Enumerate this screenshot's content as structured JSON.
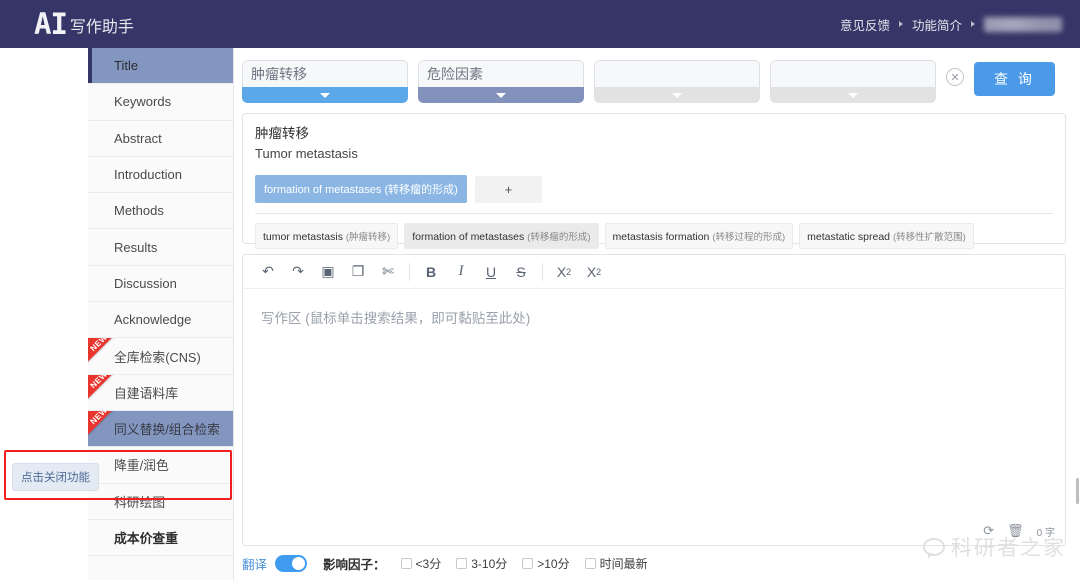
{
  "header": {
    "logo_ai": "AI",
    "logo_cn": "写作助手",
    "links": [
      {
        "label": "意见反馈"
      },
      {
        "label": "功能简介"
      }
    ],
    "blurred_account": ""
  },
  "sidebar": {
    "items": [
      {
        "label": "Title",
        "active": true,
        "new": false,
        "bold": false
      },
      {
        "label": "Keywords",
        "active": false,
        "new": false,
        "bold": false
      },
      {
        "label": "Abstract",
        "active": false,
        "new": false,
        "bold": false
      },
      {
        "label": "Introduction",
        "active": false,
        "new": false,
        "bold": false
      },
      {
        "label": "Methods",
        "active": false,
        "new": false,
        "bold": false
      },
      {
        "label": "Results",
        "active": false,
        "new": false,
        "bold": false
      },
      {
        "label": "Discussion",
        "active": false,
        "new": false,
        "bold": false
      },
      {
        "label": "Acknowledge",
        "active": false,
        "new": false,
        "bold": false
      },
      {
        "label": "全库检索(CNS)",
        "active": false,
        "new": true,
        "bold": false
      },
      {
        "label": "自建语料库",
        "active": false,
        "new": true,
        "bold": false
      },
      {
        "label": "同义替换/组合检索",
        "active": false,
        "new": true,
        "bold": false,
        "highlighted": true
      },
      {
        "label": "降重/润色",
        "active": false,
        "new": false,
        "bold": false
      },
      {
        "label": "科研绘图",
        "active": false,
        "new": false,
        "bold": false
      },
      {
        "label": "成本价查重",
        "active": false,
        "new": false,
        "bold": true
      }
    ],
    "new_badge": "NEW",
    "close_feature_button": "点击关闭功能"
  },
  "search": {
    "fields": [
      {
        "value": "肿瘤转移",
        "placeholder": "",
        "bar": "blue"
      },
      {
        "value": "危险因素",
        "placeholder": "",
        "bar": "slate"
      },
      {
        "value": "",
        "placeholder": "",
        "bar": "grey"
      },
      {
        "value": "",
        "placeholder": "",
        "bar": "grey"
      }
    ],
    "clear_icon": "close-circle-icon",
    "query_button": "查 询"
  },
  "results": {
    "title_cn": "肿瘤转移",
    "title_en": "Tumor metastasis",
    "selected_chip": "formation of metastases (转移瘤的形成)",
    "add_button": "+",
    "suggestions": [
      {
        "en": "tumor metastasis",
        "cn": "(肿瘤转移)",
        "selected": false
      },
      {
        "en": "formation of metastases",
        "cn": "(转移瘤的形成)",
        "selected": true
      },
      {
        "en": "metastasis formation",
        "cn": "(转移过程的形成)",
        "selected": false
      },
      {
        "en": "metastatic spread",
        "cn": "(转移性扩散范围)",
        "selected": false
      }
    ]
  },
  "editor": {
    "toolbar": [
      {
        "name": "undo-icon",
        "glyph": "↶"
      },
      {
        "name": "redo-icon",
        "glyph": "↷"
      },
      {
        "name": "select-all-icon",
        "glyph": "▣"
      },
      {
        "name": "copy-icon",
        "glyph": "❐"
      },
      {
        "name": "cut-icon",
        "glyph": "✄"
      },
      {
        "name": "bold-icon",
        "glyph": "B"
      },
      {
        "name": "italic-icon",
        "glyph": "I"
      },
      {
        "name": "underline-icon",
        "glyph": "U"
      },
      {
        "name": "strikethrough-icon",
        "glyph": "S"
      },
      {
        "name": "subscript-icon",
        "glyph": "X"
      },
      {
        "name": "superscript-icon",
        "glyph": "X"
      }
    ],
    "placeholder": "写作区 (鼠标单击搜索结果，即可黏贴至此处)",
    "restore_icon": "restore-icon",
    "delete_icon": "trash-icon",
    "word_count": "0 字"
  },
  "bottom": {
    "translate_label": "翻译",
    "translate_on": true,
    "impact_factor_label": "影响因子：",
    "filters": [
      {
        "label": "<3分",
        "checked": false
      },
      {
        "label": "3-10分",
        "checked": false
      },
      {
        "label": ">10分",
        "checked": false
      },
      {
        "label": "时间最新",
        "checked": false
      }
    ]
  },
  "watermark": {
    "text": "科研者之家",
    "icon": "wechat-icon"
  },
  "colors": {
    "header_bg": "#353567",
    "accent_blue": "#4a9ae8",
    "sidebar_active": "#8296bf",
    "ribbon_red": "#e8352e",
    "highlight_red": "#f21f1f"
  }
}
